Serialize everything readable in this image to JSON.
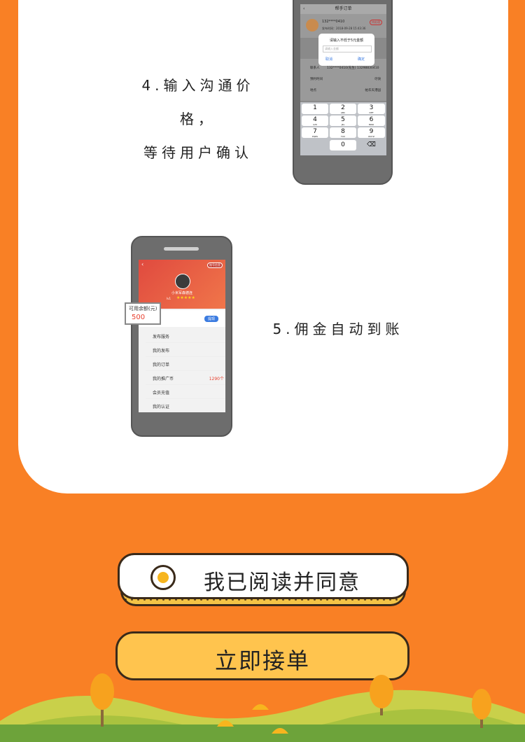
{
  "step4": {
    "line1": "4.输入沟通价格，",
    "line2": "等待用户确认",
    "phone": {
      "header_title": "帮手订单",
      "user_phone": "132****0410",
      "publish_time": "发布时间：2018-09-28 15:43:36",
      "status_badge": "待处理",
      "dialog_title": "请输入不低于5元金额",
      "dialog_placeholder": "请输入金额",
      "dialog_cancel": "取消",
      "dialog_ok": "确定",
      "contact_label": "联系人",
      "contact_value": "132****0410(先生) 13298830410",
      "time_label": "预约时间",
      "time_value": "尽快",
      "place_label": "地点",
      "place_value": "帕华天港园",
      "keys": [
        {
          "num": "1",
          "sub": ""
        },
        {
          "num": "2",
          "sub": "ABC"
        },
        {
          "num": "3",
          "sub": "DEF"
        },
        {
          "num": "4",
          "sub": "GHI"
        },
        {
          "num": "5",
          "sub": "JKL"
        },
        {
          "num": "6",
          "sub": "MNO"
        },
        {
          "num": "7",
          "sub": "PQRS"
        },
        {
          "num": "8",
          "sub": "TUV"
        },
        {
          "num": "9",
          "sub": "WXYZ"
        },
        {
          "num": "0",
          "sub": ""
        }
      ]
    }
  },
  "step5": {
    "text": "5.佣金自动到账",
    "phone": {
      "top_badge": "账号信息",
      "user_name": "小米军森德连",
      "level": "lv1",
      "stars": "★★★★★",
      "balance_label": "可用余额(元)",
      "balance_value": "500",
      "withdraw_button": "提现",
      "menu": [
        {
          "label": "发布服务",
          "extra": ""
        },
        {
          "label": "我的发布",
          "extra": ""
        },
        {
          "label": "我的订单",
          "extra": ""
        },
        {
          "label": "我的推广币",
          "extra": "1290个"
        },
        {
          "label": "会员充值",
          "extra": ""
        },
        {
          "label": "我的认证",
          "extra": ""
        }
      ]
    }
  },
  "agree": {
    "label": "我已阅读并同意"
  },
  "accept": {
    "label": "立即接单"
  },
  "colors": {
    "background": "#F98025",
    "button": "#FFC44E",
    "accent_red": "#E8402F"
  }
}
